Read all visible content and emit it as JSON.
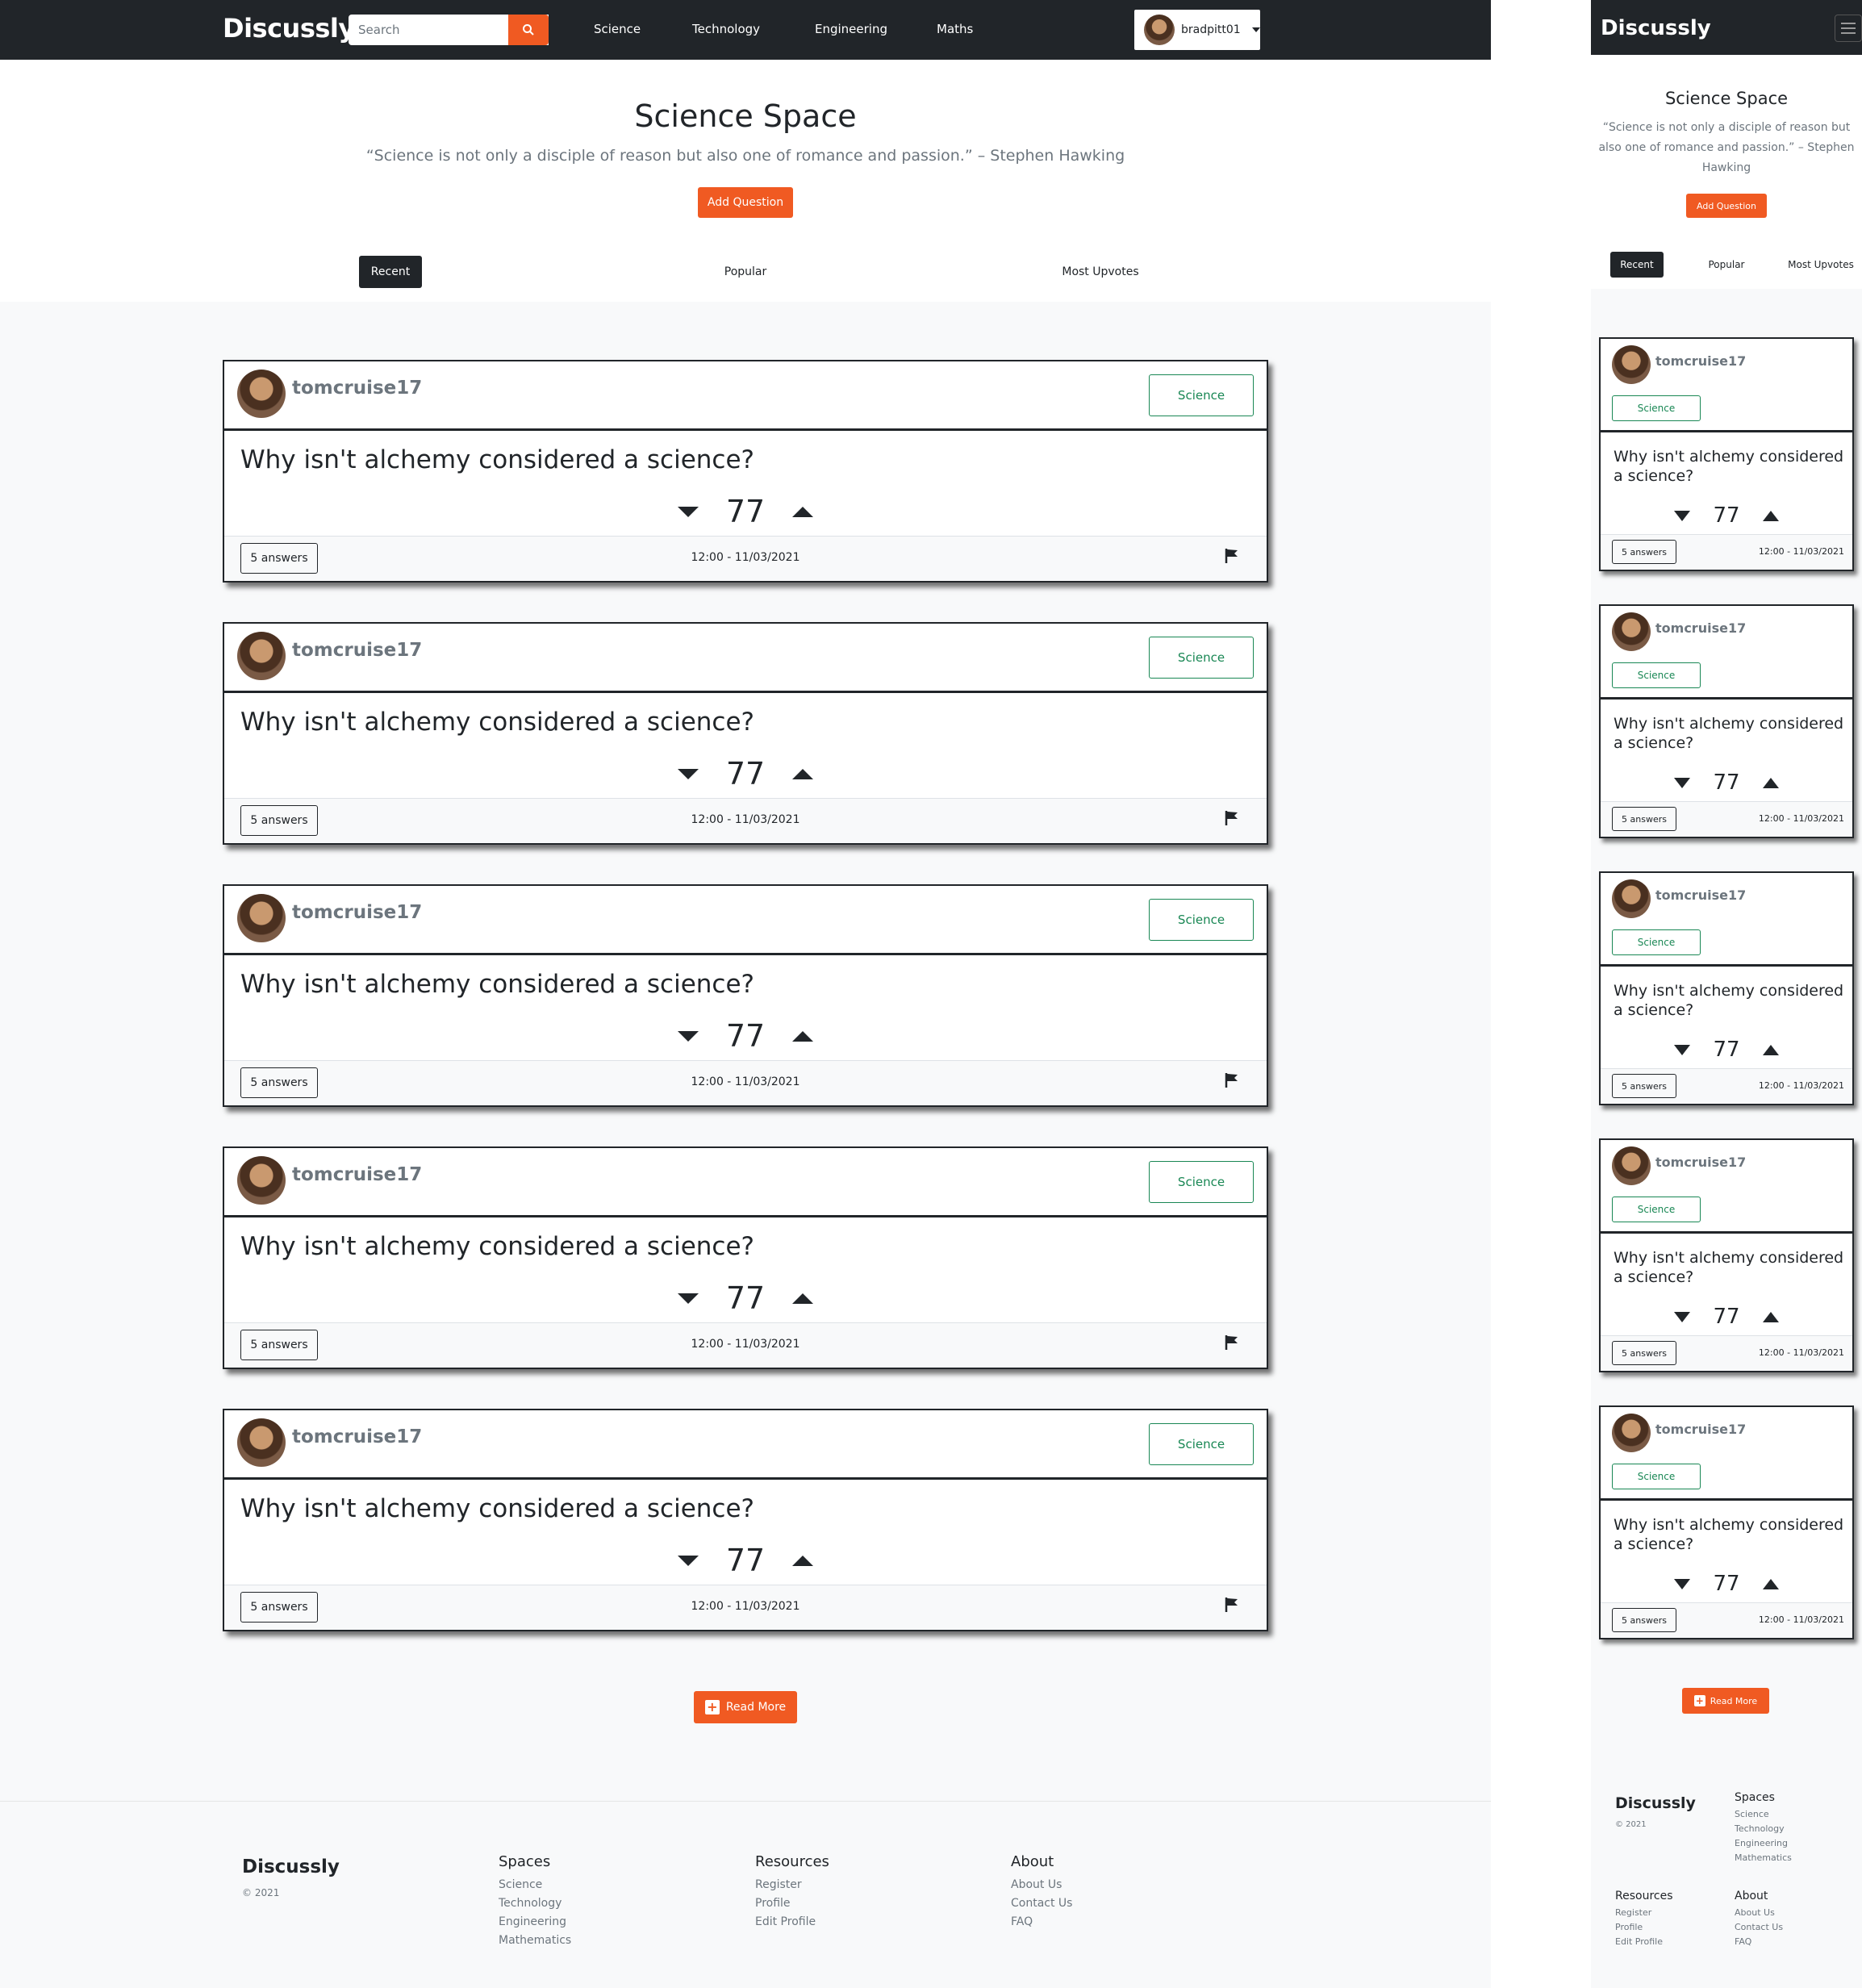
{
  "brand": "Discussly",
  "search": {
    "placeholder": "Search"
  },
  "nav": [
    "Science",
    "Technology",
    "Engineering",
    "Maths"
  ],
  "user": {
    "name": "bradpitt01"
  },
  "hero": {
    "title": "Science Space",
    "quote": "“Science is not only a disciple of reason but also one of romance and passion.” – Stephen Hawking",
    "add_question": "Add Question"
  },
  "tabs": [
    "Recent",
    "Popular",
    "Most Upvotes"
  ],
  "questions": [
    {
      "author": "tomcruise17",
      "space": "Science",
      "title": "Why isn't alchemy considered a science?",
      "votes": "77",
      "answers": "5 answers",
      "time": "12:00 - 11/03/2021"
    },
    {
      "author": "tomcruise17",
      "space": "Science",
      "title": "Why isn't alchemy considered a science?",
      "votes": "77",
      "answers": "5 answers",
      "time": "12:00 - 11/03/2021"
    },
    {
      "author": "tomcruise17",
      "space": "Science",
      "title": "Why isn't alchemy considered a science?",
      "votes": "77",
      "answers": "5 answers",
      "time": "12:00 - 11/03/2021"
    },
    {
      "author": "tomcruise17",
      "space": "Science",
      "title": "Why isn't alchemy considered a science?",
      "votes": "77",
      "answers": "5 answers",
      "time": "12:00 - 11/03/2021"
    },
    {
      "author": "tomcruise17",
      "space": "Science",
      "title": "Why isn't alchemy considered a science?",
      "votes": "77",
      "answers": "5 answers",
      "time": "12:00 - 11/03/2021"
    }
  ],
  "read_more": "Read More",
  "footer": {
    "brand": "Discussly",
    "copyright": "© 2021",
    "columns": [
      {
        "title": "Spaces",
        "links": [
          "Science",
          "Technology",
          "Engineering",
          "Mathematics"
        ]
      },
      {
        "title": "Resources",
        "links": [
          "Register",
          "Profile",
          "Edit Profile"
        ]
      },
      {
        "title": "About",
        "links": [
          "About Us",
          "Contact Us",
          "FAQ"
        ]
      }
    ]
  },
  "colors": {
    "accent": "#f05a22",
    "dark": "#212529",
    "science": "#198754"
  }
}
